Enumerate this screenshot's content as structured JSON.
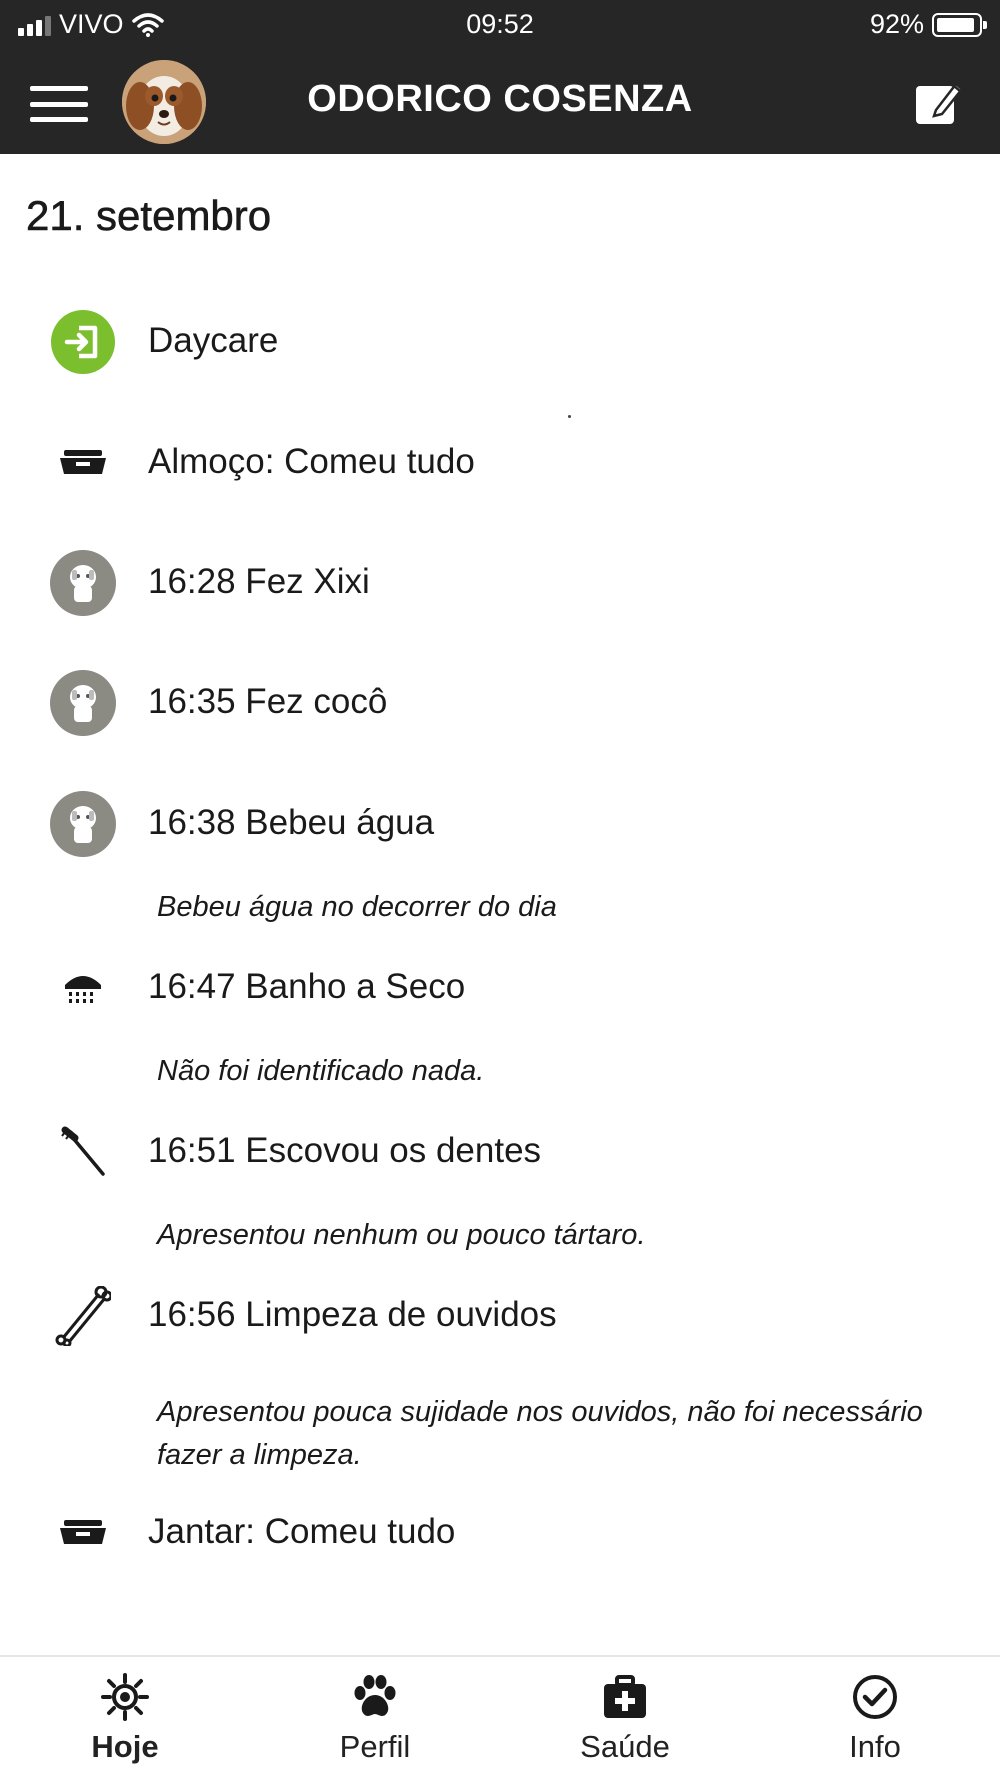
{
  "status_bar": {
    "carrier": "VIVO",
    "time": "09:52",
    "battery": "92%",
    "battery_level": 0.92
  },
  "header": {
    "title": "ODORICO COSENZA",
    "menu_icon": "hamburger-menu-icon",
    "avatar": "dog-avatar",
    "edit_icon": "edit-note-icon"
  },
  "date_heading": "21. setembro",
  "entries": [
    {
      "label": "Daycare",
      "icon": "check-in-icon",
      "note": ""
    },
    {
      "label": "Almoço: Comeu tudo",
      "icon": "food-bowl-icon",
      "note": ""
    },
    {
      "label": "16:28 Fez Xixi",
      "icon": "dog-icon",
      "note": ""
    },
    {
      "label": "16:35 Fez cocô",
      "icon": "dog-icon",
      "note": ""
    },
    {
      "label": "16:38 Bebeu água",
      "icon": "dog-icon",
      "note": "Bebeu água no decorrer do dia"
    },
    {
      "label": "16:47 Banho a Seco",
      "icon": "shower-icon",
      "note": "Não foi identificado nada."
    },
    {
      "label": "16:51 Escovou os dentes",
      "icon": "toothbrush-icon",
      "note": "Apresentou nenhum ou pouco tártaro."
    },
    {
      "label": "16:56 Limpeza de ouvidos",
      "icon": "cotton-swab-icon",
      "note": "Apresentou pouca sujidade nos ouvidos, não foi necessário fazer a limpeza."
    },
    {
      "label": "Jantar: Comeu tudo",
      "icon": "food-bowl-icon",
      "note": ""
    }
  ],
  "bottom_nav": [
    {
      "label": "Hoje",
      "icon": "sun-icon",
      "active": true
    },
    {
      "label": "Perfil",
      "icon": "paw-icon",
      "active": false
    },
    {
      "label": "Saúde",
      "icon": "first-aid-kit-icon",
      "active": false
    },
    {
      "label": "Info",
      "icon": "check-circle-icon",
      "active": false
    }
  ]
}
